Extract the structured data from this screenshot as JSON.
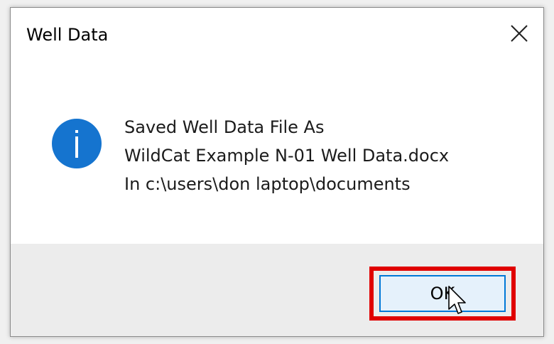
{
  "window": {
    "title": "Well Data",
    "close_icon": "close-icon"
  },
  "message": {
    "icon": "info-icon",
    "lines": [
      "Saved Well Data File As",
      "WildCat Example N-01 Well Data.docx",
      "In c:\\users\\don laptop\\documents"
    ]
  },
  "buttons": {
    "ok_label": "OK"
  },
  "colors": {
    "info_icon": "#1574cf",
    "highlight": "#e00000",
    "button_border": "#0078d7",
    "button_fill": "#e5f1fb",
    "footer_bg": "#ececec"
  }
}
